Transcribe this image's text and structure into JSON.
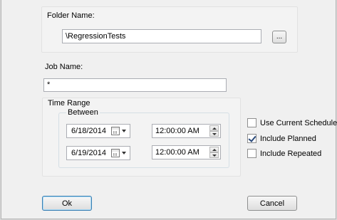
{
  "folder": {
    "label": "Folder Name:",
    "value": "\\RegressionTests",
    "browse_label": "..."
  },
  "job": {
    "label": "Job Name:",
    "value": "*"
  },
  "time_range": {
    "label": "Time Range",
    "between_label": "Between",
    "start_date": "6/18/2014",
    "start_time": "12:00:00 AM",
    "end_date": "6/19/2014",
    "end_time": "12:00:00 AM"
  },
  "options": [
    {
      "label": "Use Current Schedule",
      "checked": false
    },
    {
      "label": "Include Planned",
      "checked": true
    },
    {
      "label": "Include Repeated",
      "checked": false
    }
  ],
  "buttons": {
    "ok": "Ok",
    "cancel": "Cancel"
  }
}
